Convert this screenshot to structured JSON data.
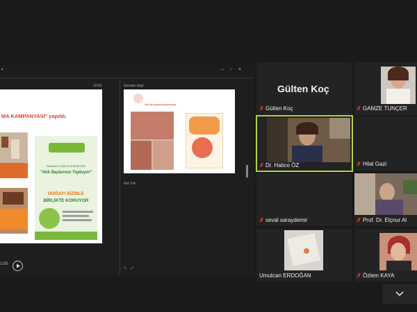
{
  "share": {
    "slide_main": {
      "title": "MA KAMPANYASI\" yapıldı.",
      "poster_header": "SAMSUN İL SAĞLIK MÜDÜRLÜĞÜ",
      "poster_quote": "\"Atık İlaçlarınızı Topluyor\"",
      "poster_line1": "DOĞAYI SİZİNLE",
      "poster_line2": "BİRLİKTE KORUYOR"
    },
    "slide_right": {
      "caption": "Atık ilaç toplama kampanyası"
    },
    "notes_label": "Not Yok",
    "page_indicator": "1/38",
    "left_time": "10:55"
  },
  "participants": {
    "gulten_big": "Gülten Koç",
    "tiles": [
      {
        "name": "Gülten Koç"
      },
      {
        "name": "GAMZE TUNÇER"
      },
      {
        "name": "Dr. Hatice ÖZ"
      },
      {
        "name": "Hilal Gazi"
      },
      {
        "name": "seval saraydemir"
      },
      {
        "name": "Prof. Dr. Elçnur Al"
      },
      {
        "name": "Umutcan ERDOĞAN"
      },
      {
        "name": "Özlem KAYA"
      }
    ]
  },
  "icons": {
    "mic_muted": "mic-muted-icon",
    "chevron": "chevron-down-icon",
    "play": "play-icon"
  },
  "colors": {
    "active_speaker": "#b3d341",
    "muted_mic": "#e53a2c"
  }
}
